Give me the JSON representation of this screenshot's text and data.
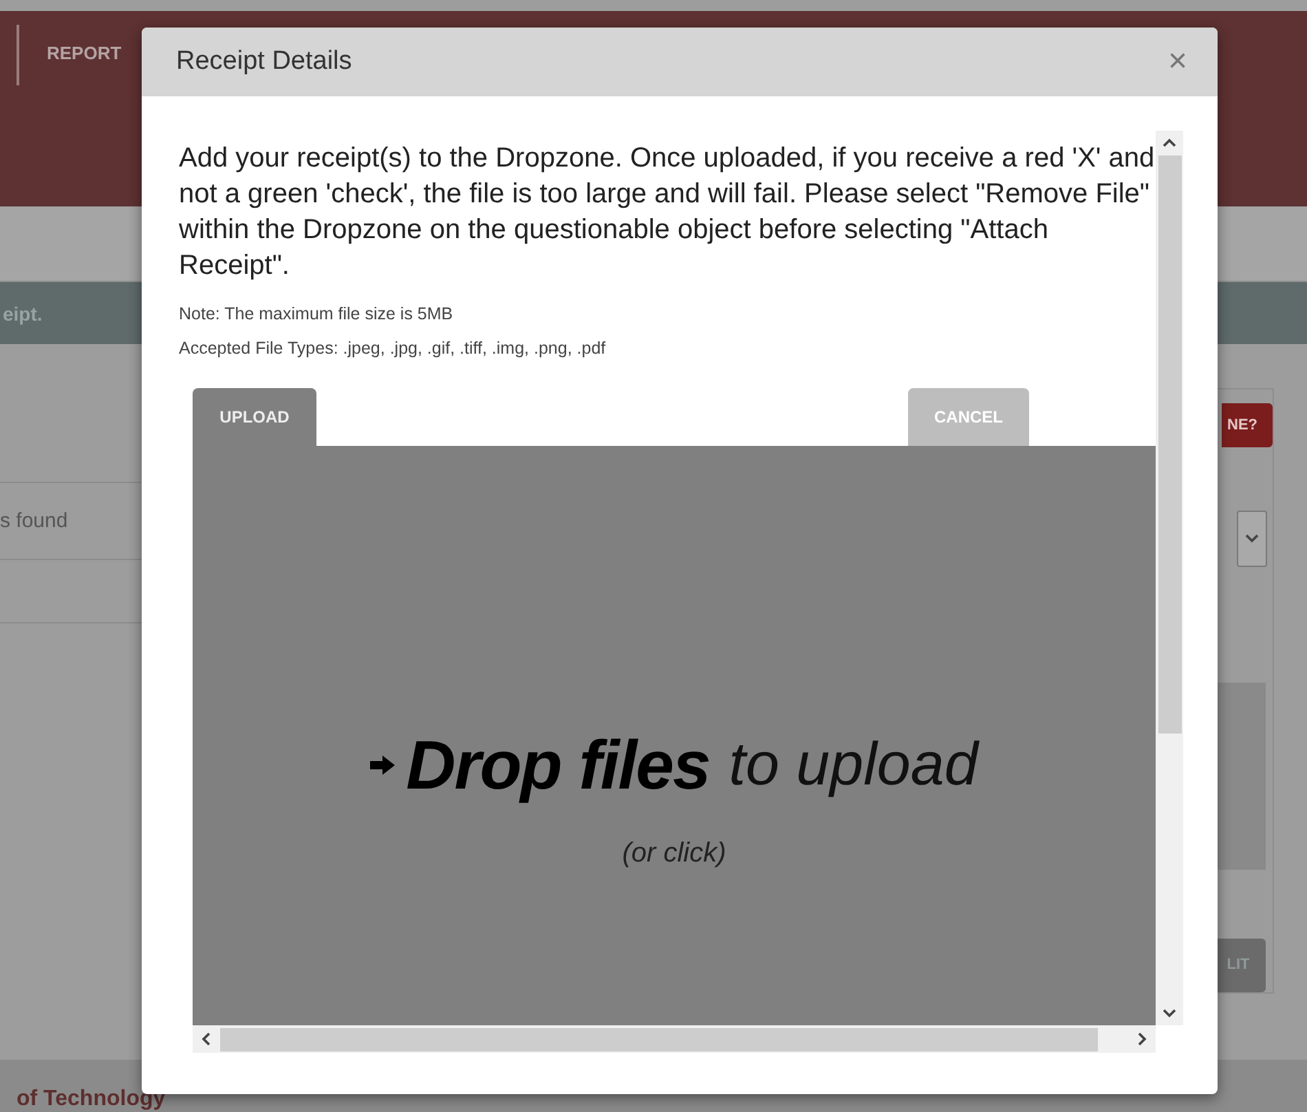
{
  "background": {
    "nav_item": "REPORT",
    "banner_text": "eipt.",
    "list_text": "s found",
    "alert_button": "NE?",
    "split_button": "LIT",
    "footer_text": "of Technology"
  },
  "modal": {
    "title": "Receipt Details",
    "close": "×",
    "instructions": "Add your receipt(s) to the Dropzone. Once uploaded, if you receive a red 'X' and not a green 'check', the file is too large and will fail. Please select \"Remove File\" within the Dropzone on the questionable object before selecting \"Attach Receipt\".",
    "note": "Note: The maximum file size is 5MB",
    "accepted_types": "Accepted File Types: .jpeg, .jpg, .gif, .tiff, .img, .png, .pdf",
    "buttons": [
      {
        "label": "UPLOAD",
        "kind": "primary"
      },
      {
        "label": "CANCEL",
        "kind": "secondary"
      }
    ],
    "dropzone": {
      "headline": "Drop files",
      "subline": "to upload",
      "hint": "(or click)"
    }
  }
}
